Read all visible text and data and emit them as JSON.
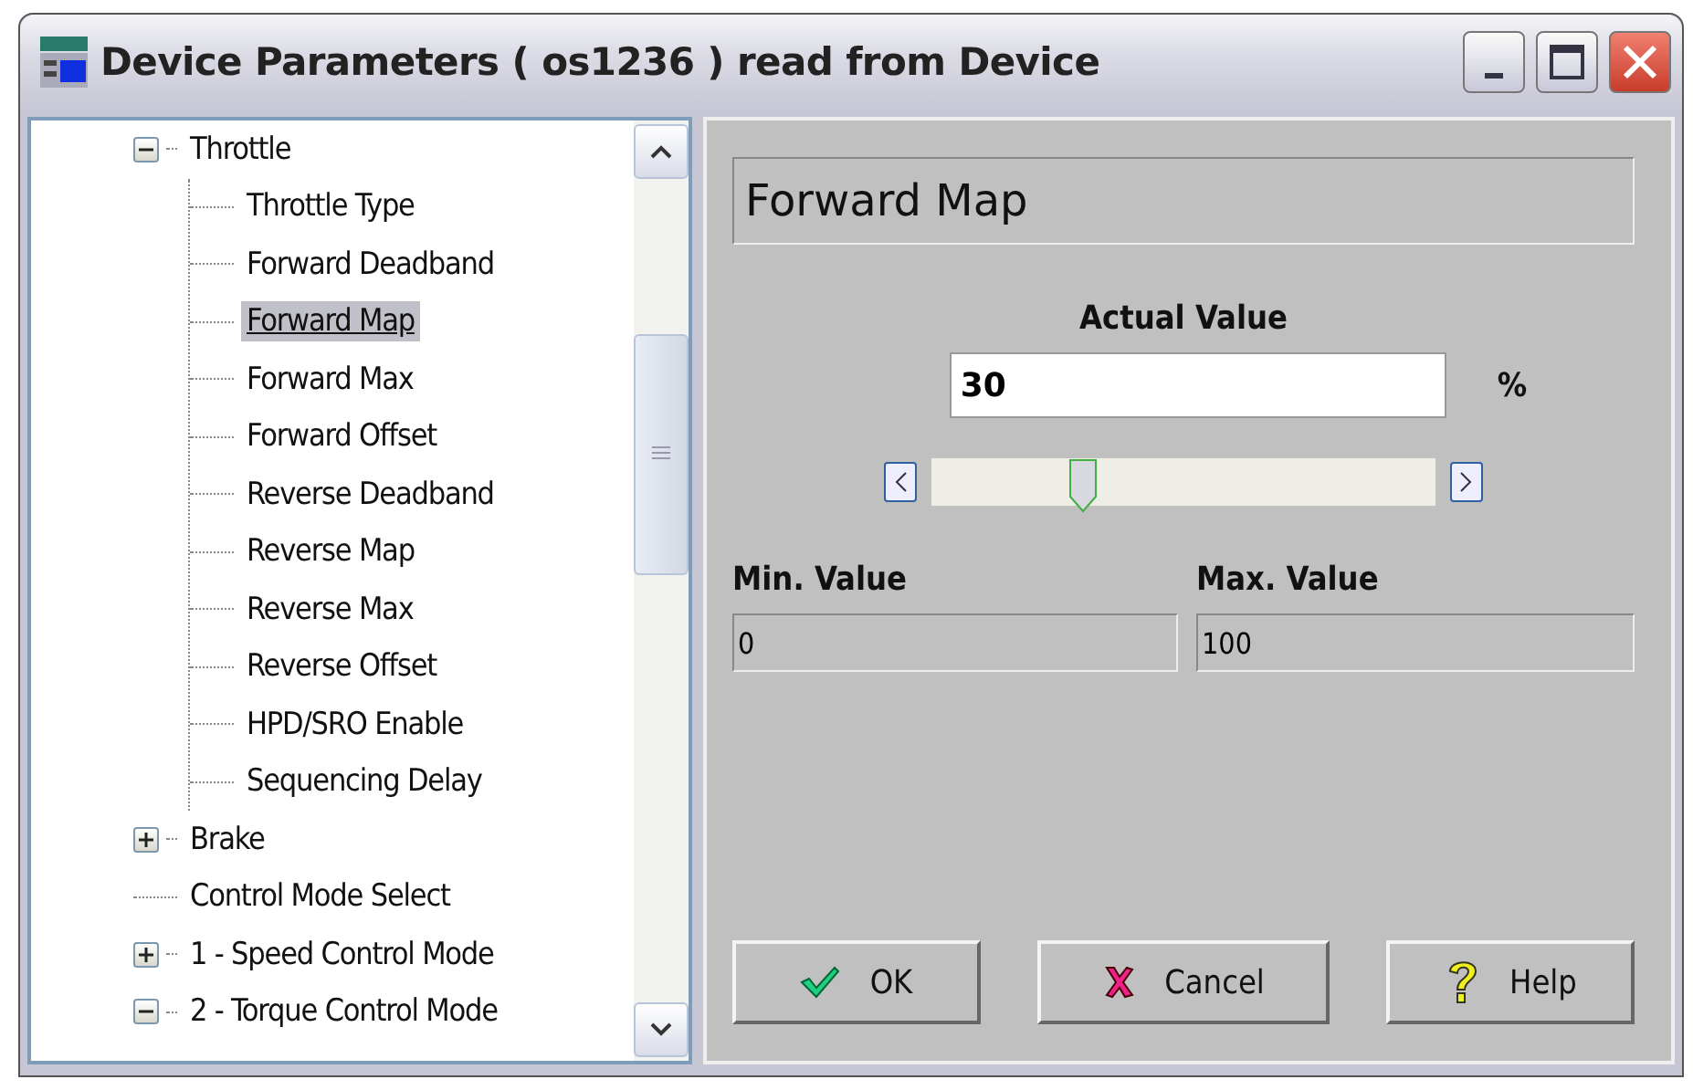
{
  "window": {
    "title": "Device Parameters ( os1236 ) read from Device"
  },
  "tree": [
    {
      "label": "Throttle",
      "kind": "folder",
      "expanded": true,
      "selected": false,
      "children": [
        {
          "label": "Throttle Type",
          "kind": "leaf",
          "selected": false
        },
        {
          "label": "Forward Deadband",
          "kind": "leaf",
          "selected": false
        },
        {
          "label": "Forward Map",
          "kind": "leaf",
          "selected": true
        },
        {
          "label": "Forward Max",
          "kind": "leaf",
          "selected": false
        },
        {
          "label": "Forward Offset",
          "kind": "leaf",
          "selected": false
        },
        {
          "label": "Reverse Deadband",
          "kind": "leaf",
          "selected": false
        },
        {
          "label": "Reverse Map",
          "kind": "leaf",
          "selected": false
        },
        {
          "label": "Reverse Max",
          "kind": "leaf",
          "selected": false
        },
        {
          "label": "Reverse Offset",
          "kind": "leaf",
          "selected": false
        },
        {
          "label": "HPD/SRO Enable",
          "kind": "leaf",
          "selected": false
        },
        {
          "label": "Sequencing Delay",
          "kind": "leaf",
          "selected": false
        }
      ]
    },
    {
      "label": "Brake",
      "kind": "folder",
      "expanded": false,
      "selected": false
    },
    {
      "label": "Control Mode Select",
      "kind": "leaf",
      "selected": false
    },
    {
      "label": "1 - Speed Control Mode",
      "kind": "folder",
      "expanded": false,
      "selected": false
    },
    {
      "label": "2 - Torque Control Mode",
      "kind": "folder",
      "expanded": true,
      "selected": false
    }
  ],
  "editor": {
    "parameter": "Forward Map",
    "actual_label": "Actual Value",
    "actual_value": "30",
    "unit": "%",
    "slider": {
      "level": 0.3
    },
    "min_label": "Min. Value",
    "min_value": "0",
    "max_label": "Max. Value",
    "max_value": "100",
    "buttons": [
      {
        "kind": "ok",
        "label": "OK"
      },
      {
        "kind": "cancel",
        "label": "Cancel"
      },
      {
        "kind": "help",
        "label": "Help"
      }
    ]
  }
}
